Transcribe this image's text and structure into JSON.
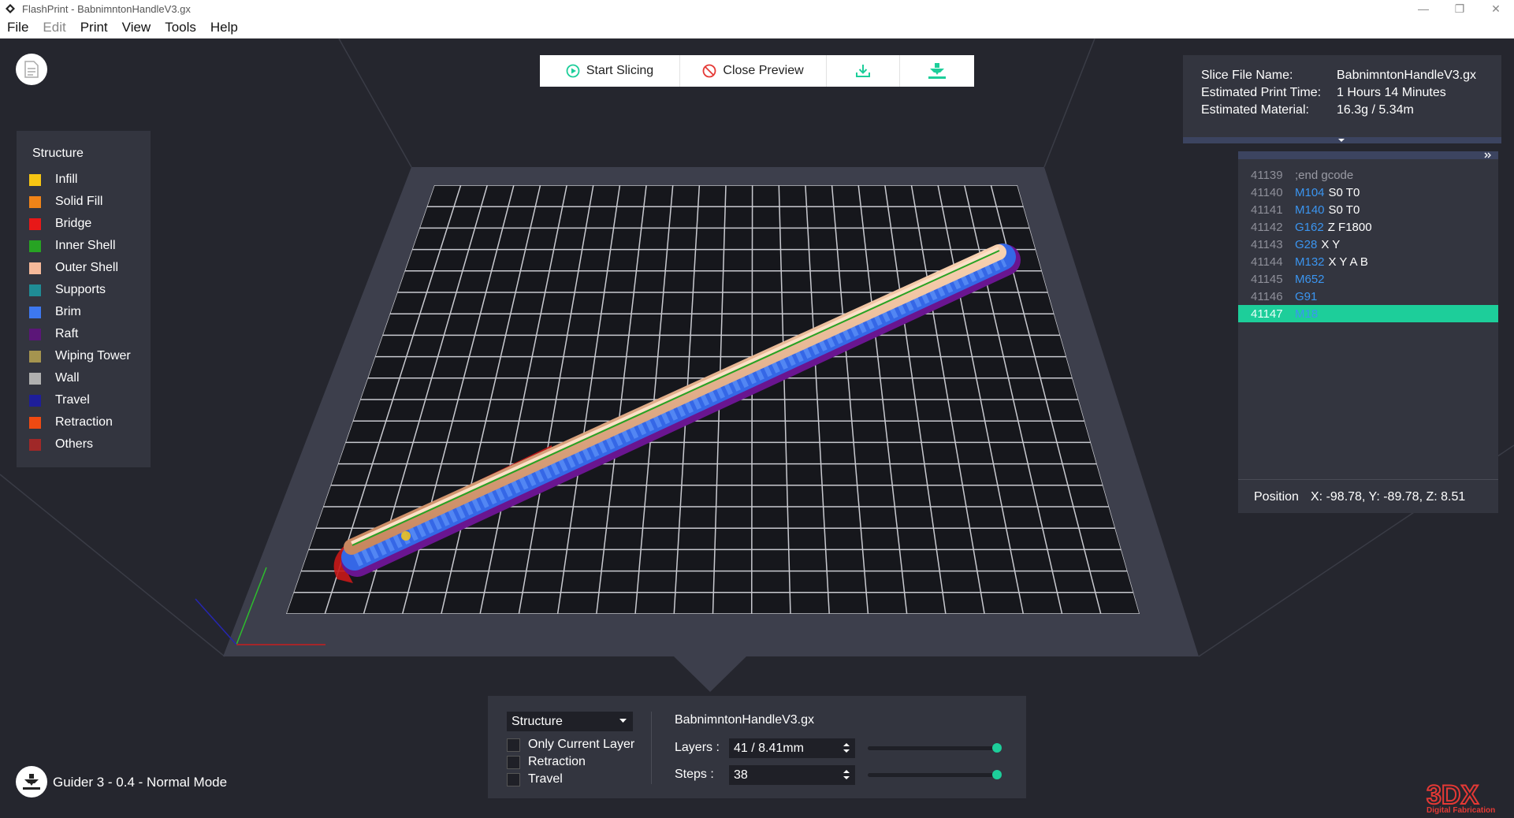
{
  "window": {
    "title": "FlashPrint - BabnimntonHandleV3.gx"
  },
  "menu": [
    {
      "label": "File",
      "enabled": true
    },
    {
      "label": "Edit",
      "enabled": false
    },
    {
      "label": "Print",
      "enabled": true
    },
    {
      "label": "View",
      "enabled": true
    },
    {
      "label": "Tools",
      "enabled": true
    },
    {
      "label": "Help",
      "enabled": true
    }
  ],
  "toolbar": {
    "start_slicing": "Start Slicing",
    "close_preview": "Close Preview"
  },
  "legend": {
    "title": "Structure",
    "items": [
      {
        "label": "Infill",
        "color": "#f6c513"
      },
      {
        "label": "Solid Fill",
        "color": "#f08418"
      },
      {
        "label": "Bridge",
        "color": "#e81818"
      },
      {
        "label": "Inner Shell",
        "color": "#27a323"
      },
      {
        "label": "Outer Shell",
        "color": "#f6b99a"
      },
      {
        "label": "Supports",
        "color": "#1f8c95"
      },
      {
        "label": "Brim",
        "color": "#3d78f0"
      },
      {
        "label": "Raft",
        "color": "#5b1678"
      },
      {
        "label": "Wiping Tower",
        "color": "#a5944f"
      },
      {
        "label": "Wall",
        "color": "#b0b0b0"
      },
      {
        "label": "Travel",
        "color": "#1e1e9a"
      },
      {
        "label": "Retraction",
        "color": "#ef4a12"
      },
      {
        "label": "Others",
        "color": "#a02828"
      }
    ]
  },
  "info": {
    "slice_file_name_label": "Slice File Name:",
    "slice_file_name": "BabnimntonHandleV3.gx",
    "print_time_label": "Estimated Print Time:",
    "print_time": "1 Hours 14 Minutes",
    "material_label": "Estimated Material:",
    "material": "16.3g / 5.34m"
  },
  "gcode": {
    "lines": [
      {
        "num": "41139",
        "cmd": "",
        "args": ";end gcode",
        "comment": true
      },
      {
        "num": "41140",
        "cmd": "M104",
        "args": "S0 T0"
      },
      {
        "num": "41141",
        "cmd": "M140",
        "args": "S0 T0"
      },
      {
        "num": "41142",
        "cmd": "G162",
        "args": "Z F1800"
      },
      {
        "num": "41143",
        "cmd": "G28",
        "args": "X Y"
      },
      {
        "num": "41144",
        "cmd": "M132",
        "args": "X Y A B"
      },
      {
        "num": "41145",
        "cmd": "M652",
        "args": ""
      },
      {
        "num": "41146",
        "cmd": "G91",
        "args": ""
      },
      {
        "num": "41147",
        "cmd": "M18",
        "args": "",
        "active": true
      }
    ],
    "position_label": "Position",
    "position_value": "X: -98.78, Y: -89.78, Z: 8.51"
  },
  "controls": {
    "view_mode": "Structure",
    "only_current_layer": "Only Current Layer",
    "retraction": "Retraction",
    "travel": "Travel",
    "file_name": "BabnimntonHandleV3.gx",
    "layers_label": "Layers :",
    "layers_value": "41 / 8.41mm",
    "layers_fraction": 1.0,
    "steps_label": "Steps :",
    "steps_value": "38",
    "steps_fraction": 1.0
  },
  "printer_mode": "Guider 3 - 0.4 - Normal Mode",
  "brand": {
    "logo_text": "3DX",
    "tagline": "Digital Fabrication"
  },
  "colors": {
    "accent": "#1dce9a",
    "panel": "#33353f",
    "background": "#25262e"
  }
}
